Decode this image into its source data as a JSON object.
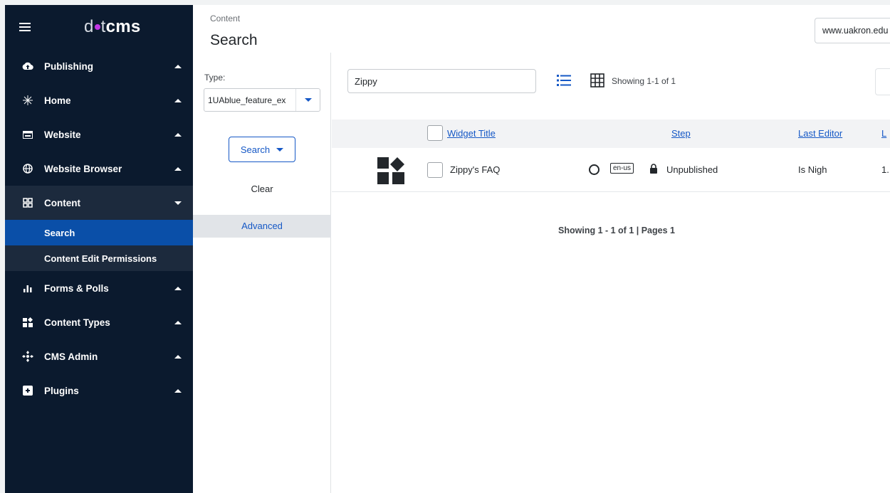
{
  "sidebar": {
    "logo": {
      "part1": "d",
      "part2": "t",
      "part3": "cms"
    },
    "items": [
      {
        "label": "Publishing",
        "icon": "cloud-upload-icon"
      },
      {
        "label": "Home",
        "icon": "sparkle-icon"
      },
      {
        "label": "Website",
        "icon": "web-page-icon"
      },
      {
        "label": "Website Browser",
        "icon": "globe-icon"
      },
      {
        "label": "Content",
        "icon": "grid-squares-icon"
      },
      {
        "label": "Forms & Polls",
        "icon": "bar-chart-icon"
      },
      {
        "label": "Content Types",
        "icon": "blocks-icon"
      },
      {
        "label": "CMS Admin",
        "icon": "cog-diamond-icon"
      },
      {
        "label": "Plugins",
        "icon": "plug-box-icon"
      }
    ],
    "content_sub": [
      {
        "label": "Search"
      },
      {
        "label": "Content Edit Permissions"
      }
    ]
  },
  "header": {
    "breadcrumb": "Content",
    "title": "Search",
    "site": "www.uakron.edu"
  },
  "search_panel": {
    "type_label": "Type:",
    "type_value": "1UAblue_feature_ex",
    "search_button": "Search",
    "clear": "Clear",
    "advanced": "Advanced"
  },
  "results": {
    "query": "Zippy",
    "showing_top": "Showing 1-1 of 1",
    "columns": {
      "title": "Widget Title",
      "step": "Step",
      "last_editor": "Last Editor",
      "last_col": "L"
    },
    "rows": [
      {
        "title": "Zippy's FAQ",
        "lang": "en-us",
        "status": "Unpublished",
        "editor": "Is Nigh",
        "last": "1."
      }
    ],
    "showing_bottom": "Showing 1 - 1 of 1 | Pages 1"
  },
  "colors": {
    "sidebar_bg": "#0b1a2e",
    "active": "#0a4fa8",
    "accent": "#1558c6",
    "logo_dot": "#c336e5"
  }
}
